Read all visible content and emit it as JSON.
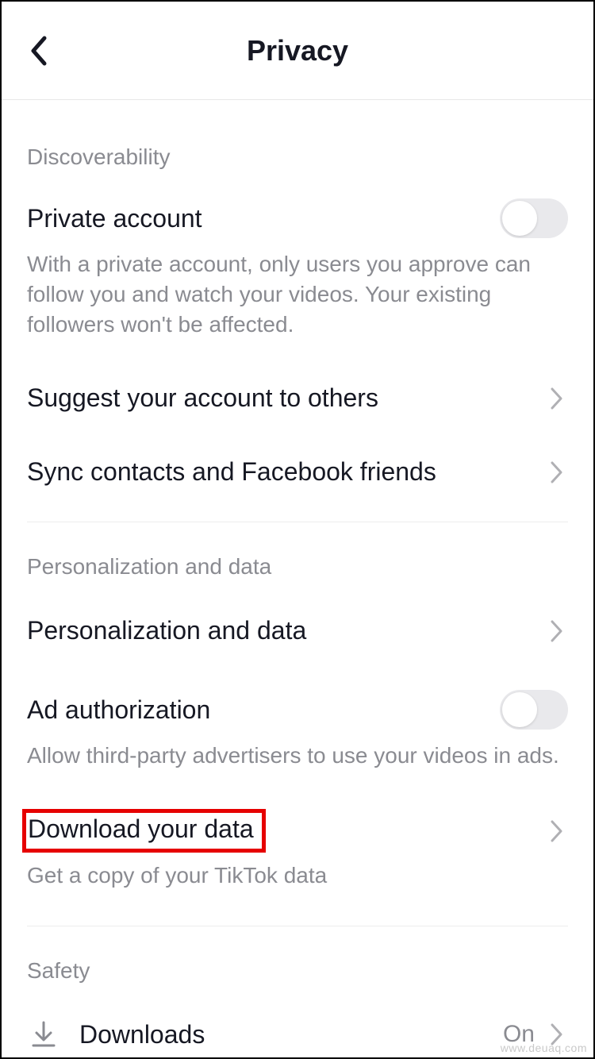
{
  "header": {
    "title": "Privacy"
  },
  "sections": {
    "discoverability": {
      "header": "Discoverability",
      "private_account": {
        "title": "Private account",
        "desc": "With a private account, only users you approve can follow you and watch your videos. Your existing followers won't be affected.",
        "toggle": false
      },
      "suggest": {
        "title": "Suggest your account to others"
      },
      "sync": {
        "title": "Sync contacts and Facebook friends"
      }
    },
    "personalization": {
      "header": "Personalization and data",
      "personalization_row": {
        "title": "Personalization and data"
      },
      "ad_auth": {
        "title": "Ad authorization",
        "desc": "Allow third-party advertisers to use your videos in ads.",
        "toggle": false
      },
      "download": {
        "title": "Download your data",
        "desc": "Get a copy of your TikTok data"
      }
    },
    "safety": {
      "header": "Safety",
      "downloads": {
        "title": "Downloads",
        "value": "On"
      }
    }
  },
  "watermark": "www.deuaq.com"
}
